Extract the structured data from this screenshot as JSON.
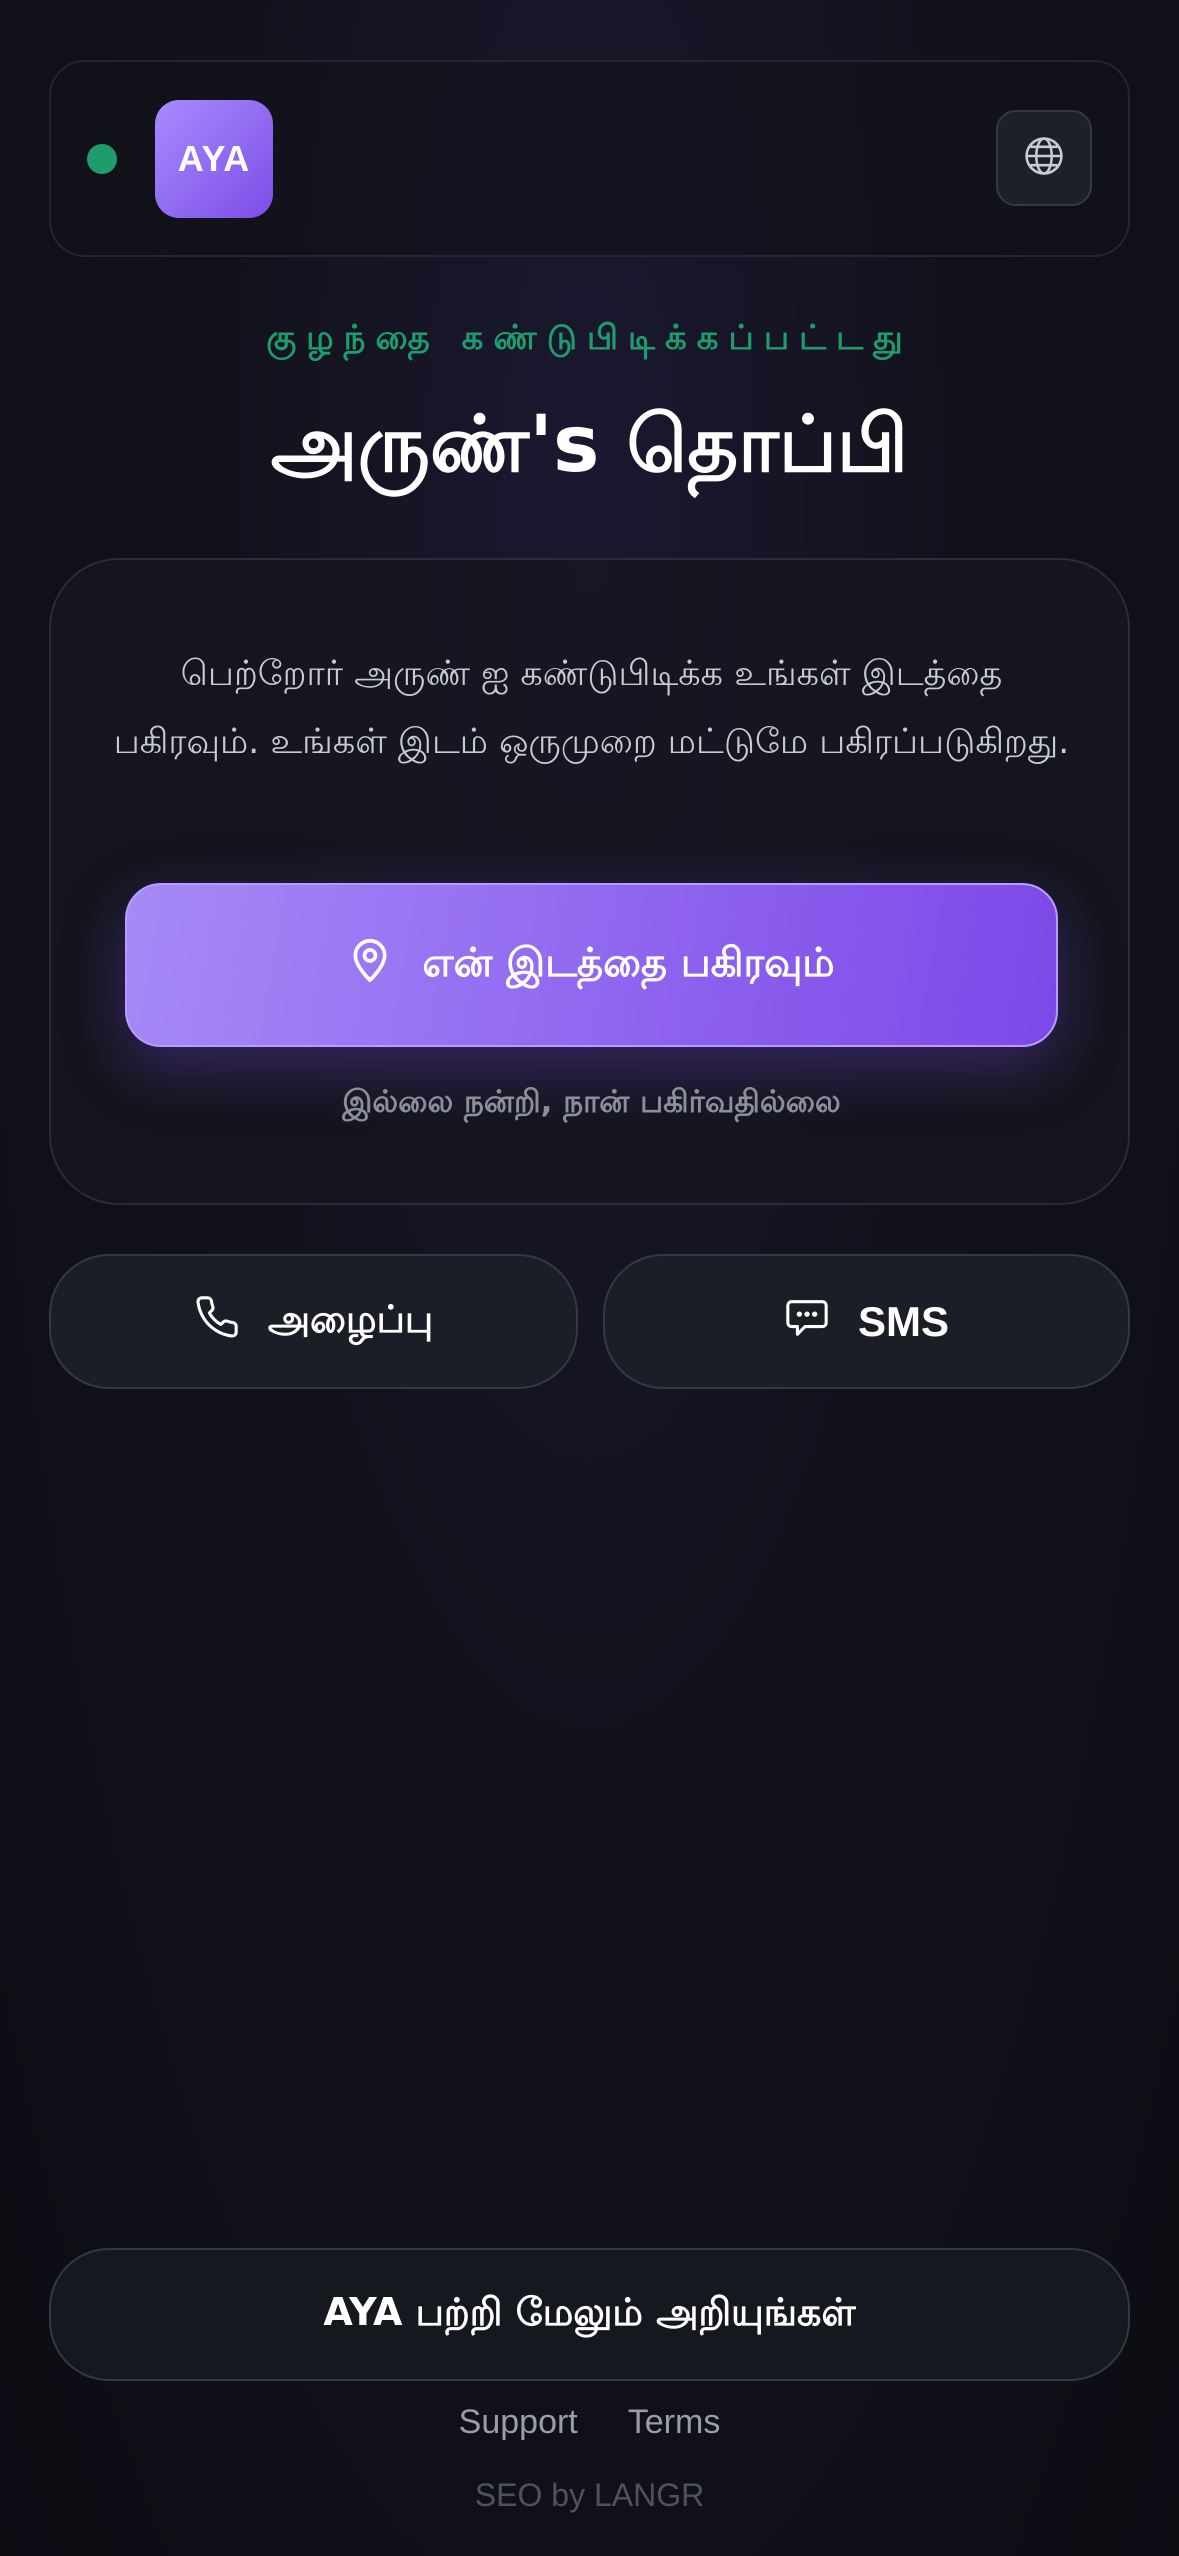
{
  "header": {
    "logo_text": "AYA",
    "status_color": "#1f9c6b",
    "language_icon": "globe-icon"
  },
  "hero": {
    "eyebrow": "குழந்தை கண்டுபிடிக்கப்பட்டது",
    "title": "அருண்'s தொப்பி"
  },
  "card": {
    "description": "பெற்றோர் அருண் ஐ கண்டுபிடிக்க உங்கள் இடத்தை பகிரவும். உங்கள் இடம் ஒருமுறை மட்டுமே பகிரப்படுகிறது.",
    "share_label": "என் இடத்தை பகிரவும்",
    "share_icon": "location-pin-icon",
    "decline_label": "இல்லை நன்றி, நான் பகிர்வதில்லை"
  },
  "actions": {
    "call_label": "அழைப்பு",
    "call_icon": "phone-icon",
    "sms_label": "SMS",
    "sms_icon": "chat-bubble-icon"
  },
  "footer": {
    "learn_more_label": "AYA பற்றி மேலும் அறியுங்கள்",
    "links": [
      "Support",
      "Terms"
    ],
    "credit": "SEO by LANGR"
  },
  "colors": {
    "accent_purple": "#8b5cf6",
    "accent_green": "#1f9c6b",
    "background": "#0f1017"
  }
}
